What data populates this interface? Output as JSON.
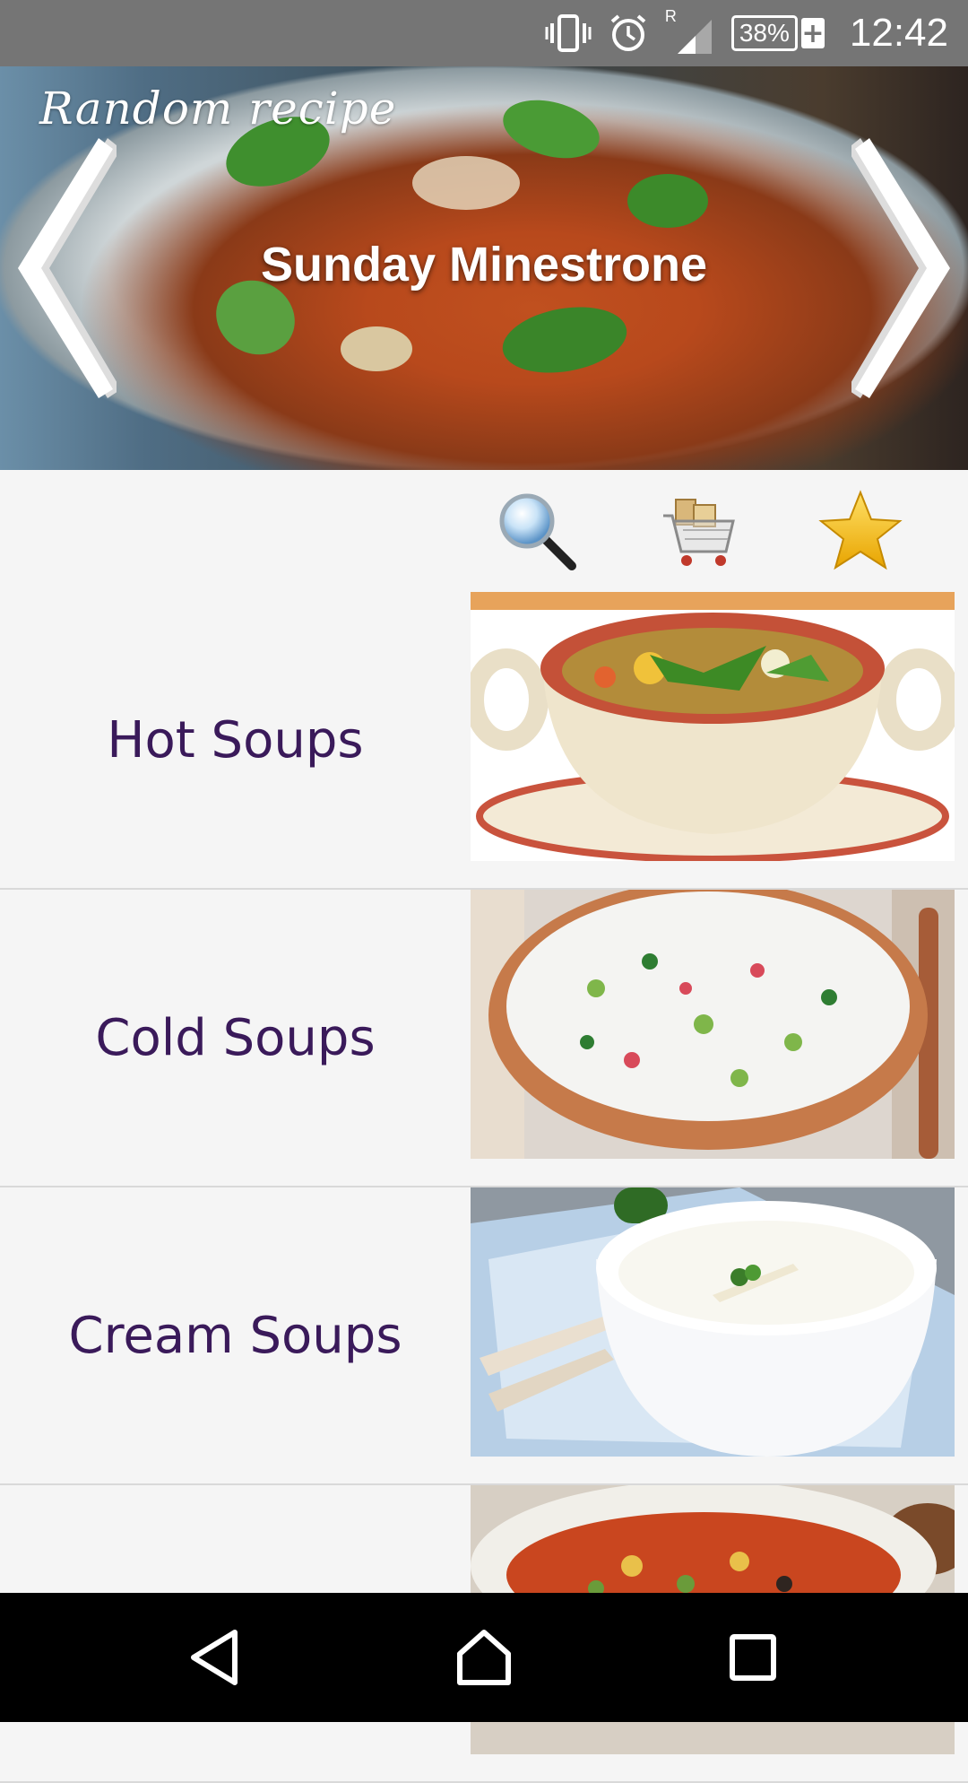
{
  "status_bar": {
    "battery_percent": "38%",
    "battery_charging_symbol": "+",
    "roaming_indicator": "R",
    "time": "12:42",
    "icons": [
      "vibrate-icon",
      "alarm-icon",
      "signal-icon",
      "battery-icon"
    ]
  },
  "hero": {
    "section_label": "Random recipe",
    "recipe_title": "Sunday Minestrone",
    "prev_icon": "chevron-left-icon",
    "next_icon": "chevron-right-icon"
  },
  "toolbar": {
    "icons": [
      "search-icon",
      "shopping-cart-icon",
      "favorites-star-icon"
    ]
  },
  "categories": [
    {
      "label": "Hot Soups",
      "image": "vegetable-soup-bowl"
    },
    {
      "label": "Cold Soups",
      "image": "cold-yogurt-soup-wooden-bowl"
    },
    {
      "label": "Cream Soups",
      "image": "cream-asparagus-soup"
    },
    {
      "label": "",
      "image": "tomato-bean-soup"
    }
  ],
  "nav_bar": {
    "icons": [
      "back-icon",
      "home-icon",
      "recents-icon"
    ]
  }
}
